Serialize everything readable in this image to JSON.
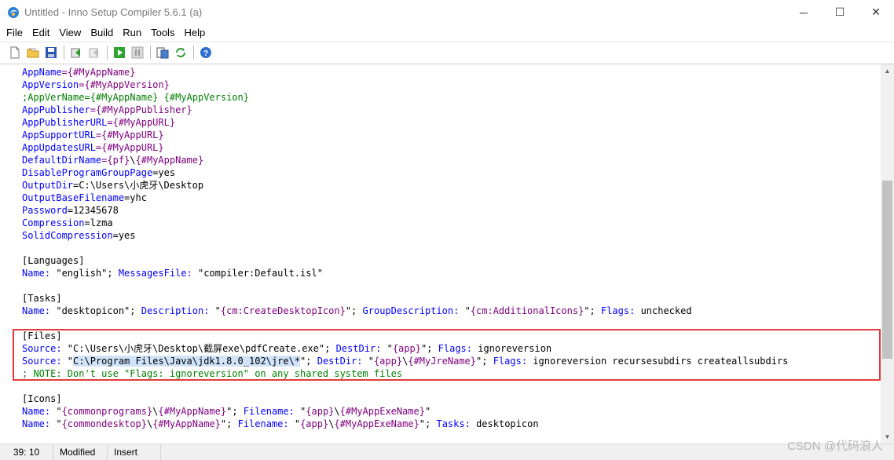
{
  "window": {
    "title": "Untitled - Inno Setup Compiler 5.6.1 (a)",
    "minimize": "─",
    "maximize": "☐",
    "close": "✕"
  },
  "menu": [
    "File",
    "Edit",
    "View",
    "Build",
    "Run",
    "Tools",
    "Help"
  ],
  "toolbar": {
    "icons": [
      "new-file-icon",
      "open-folder-icon",
      "save-icon",
      "compile-icon",
      "stop-compile-icon",
      "run-icon",
      "pause-icon",
      "target-icon",
      "refresh-icon",
      "help-icon"
    ]
  },
  "editor": {
    "lines": [
      [
        {
          "t": "AppName",
          "c": "k"
        },
        {
          "t": "={#MyAppName}",
          "c": "co"
        }
      ],
      [
        {
          "t": "AppVersion",
          "c": "k"
        },
        {
          "t": "={#MyAppVersion}",
          "c": "co"
        }
      ],
      [
        {
          "t": ";AppVerName={#MyAppName} {#MyAppVersion}",
          "c": "c"
        }
      ],
      [
        {
          "t": "AppPublisher",
          "c": "k"
        },
        {
          "t": "={#MyAppPublisher}",
          "c": "co"
        }
      ],
      [
        {
          "t": "AppPublisherURL",
          "c": "k"
        },
        {
          "t": "={#MyAppURL}",
          "c": "co"
        }
      ],
      [
        {
          "t": "AppSupportURL",
          "c": "k"
        },
        {
          "t": "={#MyAppURL}",
          "c": "co"
        }
      ],
      [
        {
          "t": "AppUpdatesURL",
          "c": "k"
        },
        {
          "t": "={#MyAppURL}",
          "c": "co"
        }
      ],
      [
        {
          "t": "DefaultDirName",
          "c": "k"
        },
        {
          "t": "={pf}",
          "c": "co"
        },
        {
          "t": "\\",
          "c": "v"
        },
        {
          "t": "{#MyAppName}",
          "c": "co"
        }
      ],
      [
        {
          "t": "DisableProgramGroupPage",
          "c": "k"
        },
        {
          "t": "=yes",
          "c": "v"
        }
      ],
      [
        {
          "t": "OutputDir",
          "c": "k"
        },
        {
          "t": "=C:\\Users\\小虎牙\\Desktop",
          "c": "v"
        }
      ],
      [
        {
          "t": "OutputBaseFilename",
          "c": "k"
        },
        {
          "t": "=yhc",
          "c": "v"
        }
      ],
      [
        {
          "t": "Password",
          "c": "k"
        },
        {
          "t": "=12345678",
          "c": "v"
        }
      ],
      [
        {
          "t": "Compression",
          "c": "k"
        },
        {
          "t": "=lzma",
          "c": "v"
        }
      ],
      [
        {
          "t": "SolidCompression",
          "c": "k"
        },
        {
          "t": "=yes",
          "c": "v"
        }
      ],
      [],
      [
        {
          "t": "[Languages]",
          "c": "h"
        }
      ],
      [
        {
          "t": "Name:",
          "c": "k"
        },
        {
          "t": " \"english\"; ",
          "c": "v"
        },
        {
          "t": "MessagesFile:",
          "c": "k"
        },
        {
          "t": " \"compiler:Default.isl\"",
          "c": "v"
        }
      ],
      [],
      [
        {
          "t": "[Tasks]",
          "c": "h"
        }
      ],
      [
        {
          "t": "Name:",
          "c": "k"
        },
        {
          "t": " \"desktopicon\"; ",
          "c": "v"
        },
        {
          "t": "Description:",
          "c": "k"
        },
        {
          "t": " \"",
          "c": "v"
        },
        {
          "t": "{cm:CreateDesktopIcon}",
          "c": "co"
        },
        {
          "t": "\"; ",
          "c": "v"
        },
        {
          "t": "GroupDescription:",
          "c": "k"
        },
        {
          "t": " \"",
          "c": "v"
        },
        {
          "t": "{cm:AdditionalIcons}",
          "c": "co"
        },
        {
          "t": "\"; ",
          "c": "v"
        },
        {
          "t": "Flags:",
          "c": "k"
        },
        {
          "t": " unchecked",
          "c": "v"
        }
      ],
      [],
      [
        {
          "t": "[Files]",
          "c": "h"
        }
      ],
      [
        {
          "t": "Source:",
          "c": "k"
        },
        {
          "t": " \"C:\\Users\\小虎牙\\Desktop\\截屏exe\\pdfCreate.exe\"; ",
          "c": "v"
        },
        {
          "t": "DestDir:",
          "c": "k"
        },
        {
          "t": " \"",
          "c": "v"
        },
        {
          "t": "{app}",
          "c": "co"
        },
        {
          "t": "\"; ",
          "c": "v"
        },
        {
          "t": "Flags:",
          "c": "k"
        },
        {
          "t": " ignoreversion",
          "c": "v"
        }
      ],
      [
        {
          "t": "Source:",
          "c": "k"
        },
        {
          "t": " \"",
          "c": "v"
        },
        {
          "t": "C:\\Program Files\\Java\\jdk1.8.0_102\\jre\\*",
          "c": "sel"
        },
        {
          "t": "\"; ",
          "c": "v"
        },
        {
          "t": "DestDir:",
          "c": "k"
        },
        {
          "t": " \"",
          "c": "v"
        },
        {
          "t": "{app}",
          "c": "co"
        },
        {
          "t": "\\",
          "c": "v"
        },
        {
          "t": "{#MyJreName}",
          "c": "co"
        },
        {
          "t": "\"; ",
          "c": "v"
        },
        {
          "t": "Flags:",
          "c": "k"
        },
        {
          "t": " ignoreversion recursesubdirs createallsubdirs",
          "c": "v"
        }
      ],
      [
        {
          "t": "; NOTE: Don't use \"Flags: ignoreversion\" on any shared system files",
          "c": "c"
        }
      ],
      [],
      [
        {
          "t": "[Icons]",
          "c": "h"
        }
      ],
      [
        {
          "t": "Name:",
          "c": "k"
        },
        {
          "t": " \"",
          "c": "v"
        },
        {
          "t": "{commonprograms}",
          "c": "co"
        },
        {
          "t": "\\",
          "c": "v"
        },
        {
          "t": "{#MyAppName}",
          "c": "co"
        },
        {
          "t": "\"; ",
          "c": "v"
        },
        {
          "t": "Filename:",
          "c": "k"
        },
        {
          "t": " \"",
          "c": "v"
        },
        {
          "t": "{app}",
          "c": "co"
        },
        {
          "t": "\\",
          "c": "v"
        },
        {
          "t": "{#MyAppExeName}",
          "c": "co"
        },
        {
          "t": "\"",
          "c": "v"
        }
      ],
      [
        {
          "t": "Name:",
          "c": "k"
        },
        {
          "t": " \"",
          "c": "v"
        },
        {
          "t": "{commondesktop}",
          "c": "co"
        },
        {
          "t": "\\",
          "c": "v"
        },
        {
          "t": "{#MyAppName}",
          "c": "co"
        },
        {
          "t": "\"; ",
          "c": "v"
        },
        {
          "t": "Filename:",
          "c": "k"
        },
        {
          "t": " \"",
          "c": "v"
        },
        {
          "t": "{app}",
          "c": "co"
        },
        {
          "t": "\\",
          "c": "v"
        },
        {
          "t": "{#MyAppExeName}",
          "c": "co"
        },
        {
          "t": "\"; ",
          "c": "v"
        },
        {
          "t": "Tasks:",
          "c": "k"
        },
        {
          "t": " desktopicon",
          "c": "v"
        }
      ]
    ]
  },
  "status": {
    "position": "39: 10",
    "modified": "Modified",
    "mode": "Insert"
  },
  "watermark": "CSDN @代码浪人"
}
